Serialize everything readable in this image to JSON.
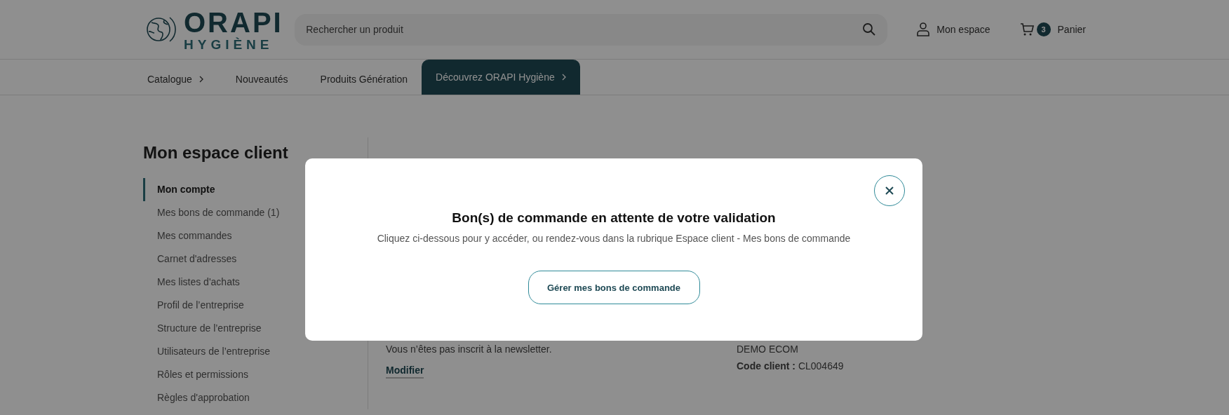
{
  "header": {
    "logo": {
      "line_1": "ORAPI",
      "line_2": "HYGIÈNE"
    },
    "search": {
      "placeholder": "Rechercher un produit"
    },
    "account": "Mon espace",
    "cart": {
      "count": "3",
      "label": "Panier"
    }
  },
  "nav": [
    {
      "label": "Catalogue",
      "has_arrow": true,
      "selected": false
    },
    {
      "label": "Nouveautés",
      "has_arrow": false,
      "selected": false
    },
    {
      "label": "Produits Génération",
      "has_arrow": false,
      "selected": false
    },
    {
      "label": "Découvrez ORAPI Hygiène",
      "has_arrow": true,
      "selected": true
    }
  ],
  "sidebar": {
    "title": "Mon espace client",
    "items": [
      {
        "label": "Mon compte",
        "selected": true
      },
      {
        "label": "Mes bons de commande (1)",
        "selected": false
      },
      {
        "label": "Mes commandes",
        "selected": false
      },
      {
        "label": "Carnet d'adresses",
        "selected": false
      },
      {
        "label": "Mes listes d'achats",
        "selected": false
      },
      {
        "label": "Profil de l’entreprise",
        "selected": false
      },
      {
        "label": "Structure de l’entreprise",
        "selected": false
      },
      {
        "label": "Utilisateurs de l’entreprise",
        "selected": false
      },
      {
        "label": "Rôles et permissions",
        "selected": false
      },
      {
        "label": "Règles d'approbation",
        "selected": false
      }
    ]
  },
  "content": {
    "newsletter": "Vous n’êtes pas inscrit à la newsletter.",
    "edit_link": "Modifier",
    "company": "DEMO ECOM",
    "client_code": "**Code client :** CL004649"
  },
  "modal": {
    "title": "Bon(s) de commande en attente de votre validation",
    "text": "Cliquez ci-dessous pour y accéder, ou rendez-vous dans la rubrique Espace client - Mes bons de commande",
    "button": "Gérer mes bons de commande"
  }
}
